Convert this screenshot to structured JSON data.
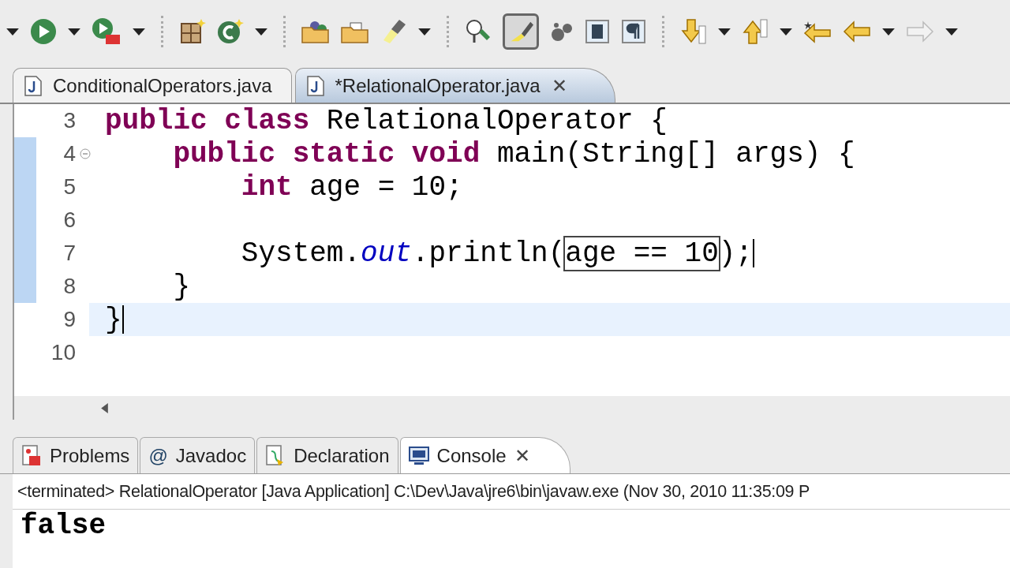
{
  "toolbar": {
    "toggle_button": {
      "on": true
    }
  },
  "editor_tabs": [
    {
      "label": "ConditionalOperators.java",
      "selected": false,
      "closable": false
    },
    {
      "label": "*RelationalOperator.java",
      "selected": true,
      "closable": true,
      "close_glyph": "✕"
    }
  ],
  "editor": {
    "lines": [
      {
        "number": "3",
        "changed": false,
        "current": false,
        "foldable": false,
        "caret": false,
        "tokens": [
          {
            "kind": "keyword",
            "text": "public class "
          },
          {
            "kind": "plain",
            "text": "RelationalOperator {"
          }
        ]
      },
      {
        "number": "4",
        "changed": true,
        "current": false,
        "foldable": true,
        "caret": false,
        "tokens": [
          {
            "kind": "keyword",
            "text": "    public static void "
          },
          {
            "kind": "plain",
            "text": "main(String[] args) {"
          }
        ]
      },
      {
        "number": "5",
        "changed": true,
        "current": false,
        "foldable": false,
        "caret": false,
        "tokens": [
          {
            "kind": "keyword",
            "text": "        int "
          },
          {
            "kind": "plain",
            "text": "age = 10;"
          }
        ]
      },
      {
        "number": "6",
        "changed": true,
        "current": false,
        "foldable": false,
        "caret": false
      },
      {
        "number": "7",
        "changed": true,
        "current": false,
        "foldable": false,
        "caret": true,
        "tokens": [
          {
            "kind": "plain",
            "text": "        System."
          },
          {
            "kind": "field",
            "text": "out"
          },
          {
            "kind": "plain",
            "text": ".println("
          },
          {
            "kind": "match",
            "text": "age == 10"
          },
          {
            "kind": "plain",
            "text": ");"
          }
        ]
      },
      {
        "number": "8",
        "changed": true,
        "current": false,
        "foldable": false,
        "caret": false,
        "tokens": [
          {
            "kind": "plain",
            "text": "    }"
          }
        ]
      },
      {
        "number": "9",
        "changed": false,
        "current": true,
        "foldable": false,
        "caret": true,
        "tokens": [
          {
            "kind": "plain",
            "text": "}"
          }
        ]
      },
      {
        "number": "10",
        "changed": false,
        "current": false,
        "foldable": false,
        "caret": false
      }
    ]
  },
  "panel_tabs": [
    {
      "label": "Problems",
      "selected": false,
      "closable": false
    },
    {
      "label": "Javadoc",
      "at_glyph": "@",
      "selected": false,
      "closable": false
    },
    {
      "label": "Declaration",
      "selected": false,
      "closable": false
    },
    {
      "label": "Console",
      "selected": true,
      "closable": true,
      "close_glyph": "✕"
    }
  ],
  "console": {
    "header": "<terminated> RelationalOperator [Java Application] C:\\Dev\\Java\\jre6\\bin\\javaw.exe (Nov 30, 2010 11:35:09 P",
    "output": "false"
  }
}
